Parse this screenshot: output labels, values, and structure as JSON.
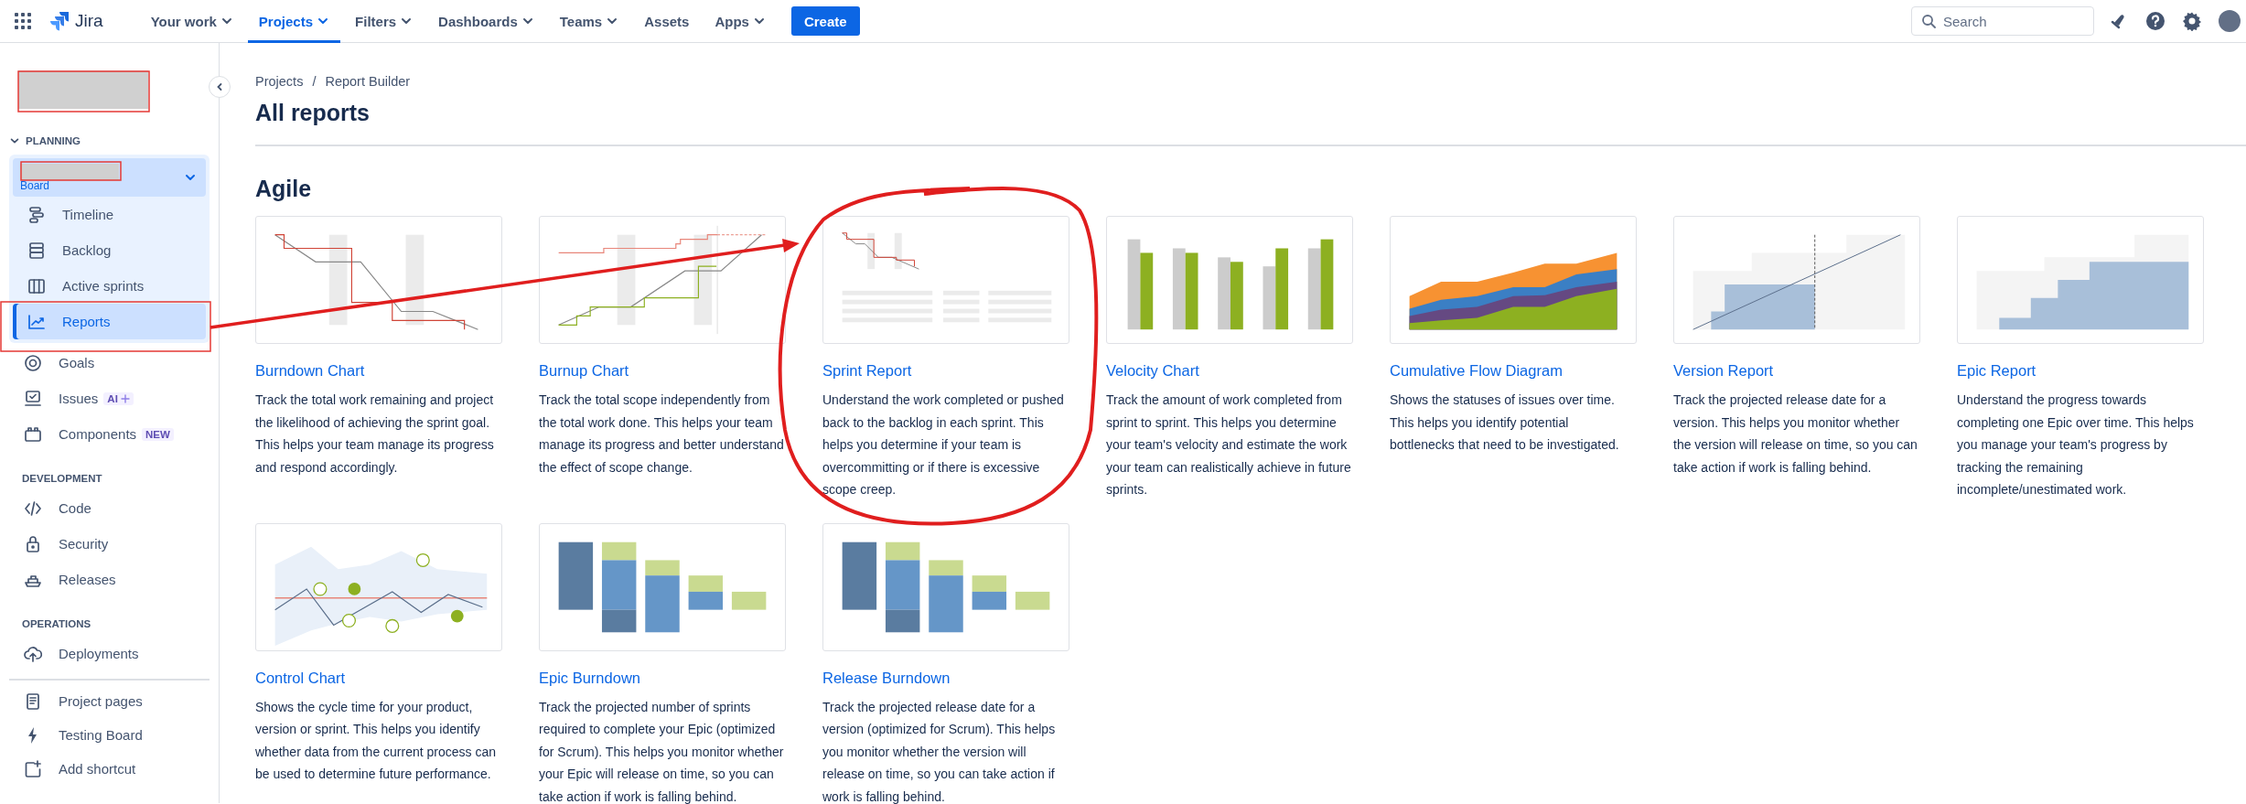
{
  "topbar": {
    "app_name": "Jira",
    "nav": [
      {
        "label": "Your work",
        "selected": false,
        "has_menu": true
      },
      {
        "label": "Projects",
        "selected": true,
        "has_menu": true
      },
      {
        "label": "Filters",
        "selected": false,
        "has_menu": true
      },
      {
        "label": "Dashboards",
        "selected": false,
        "has_menu": true
      },
      {
        "label": "Teams",
        "selected": false,
        "has_menu": true
      },
      {
        "label": "Assets",
        "selected": false,
        "has_menu": false
      },
      {
        "label": "Apps",
        "selected": false,
        "has_menu": true
      }
    ],
    "create_button": "Create",
    "search": {
      "placeholder": "Search"
    }
  },
  "sidebar": {
    "sections": [
      {
        "kind": "planning",
        "heading": "PLANNING",
        "expanded": true,
        "board": {
          "label": "Board",
          "expanded": true,
          "items": [
            {
              "label": "Timeline",
              "selected": false
            },
            {
              "label": "Backlog",
              "selected": false
            },
            {
              "label": "Active sprints",
              "selected": false
            },
            {
              "label": "Reports",
              "selected": true
            }
          ]
        },
        "items": [
          {
            "label": "Goals",
            "selected": false
          },
          {
            "label": "Issues",
            "selected": false,
            "badge": {
              "kind": "ai",
              "text": "AI"
            }
          },
          {
            "label": "Components",
            "selected": false,
            "badge": {
              "kind": "new",
              "text": "NEW"
            }
          }
        ]
      },
      {
        "kind": "plain",
        "heading": "DEVELOPMENT",
        "items": [
          {
            "label": "Code",
            "selected": false
          },
          {
            "label": "Security",
            "selected": false
          },
          {
            "label": "Releases",
            "selected": false
          }
        ]
      },
      {
        "kind": "plain",
        "heading": "OPERATIONS",
        "items": [
          {
            "label": "Deployments",
            "selected": false
          }
        ]
      },
      {
        "kind": "footer",
        "items": [
          {
            "label": "Project pages",
            "selected": false
          },
          {
            "label": "Testing Board",
            "selected": false
          },
          {
            "label": "Add shortcut",
            "selected": false
          }
        ]
      }
    ]
  },
  "main": {
    "breadcrumb": {
      "items": [
        "Projects",
        "Report Builder"
      ],
      "separator": "/"
    },
    "title": "All reports",
    "section_title": "Agile",
    "reports": [
      {
        "title": "Burndown Chart",
        "description": "Track the total work remaining and project the likelihood of achieving the sprint goal. This helps your team manage its progress and respond accordingly."
      },
      {
        "title": "Burnup Chart",
        "description": "Track the total scope independently from the total work done. This helps your team manage its progress and better understand the effect of scope change."
      },
      {
        "title": "Sprint Report",
        "description": "Understand the work completed or pushed back to the backlog in each sprint. This helps you determine if your team is overcommitting or if there is excessive scope creep."
      },
      {
        "title": "Velocity Chart",
        "description": "Track the amount of work completed from sprint to sprint. This helps you determine your team's velocity and estimate the work your team can realistically achieve in future sprints."
      },
      {
        "title": "Cumulative Flow Diagram",
        "description": "Shows the statuses of issues over time. This helps you identify potential bottlenecks that need to be investigated."
      },
      {
        "title": "Version Report",
        "description": "Track the projected release date for a version. This helps you monitor whether the version will release on time, so you can take action if work is falling behind."
      },
      {
        "title": "Epic Report",
        "description": "Understand the progress towards completing one Epic over time. This helps you manage your team's progress by tracking the remaining incomplete/unestimated work."
      },
      {
        "title": "Control Chart",
        "description": "Shows the cycle time for your product, version or sprint. This helps you identify whether data from the current process can be used to determine future performance."
      },
      {
        "title": "Epic Burndown",
        "description": "Track the projected number of sprints required to complete your Epic (optimized for Scrum). This helps you monitor whether your Epic will release on time, so you can take action if work is falling behind."
      },
      {
        "title": "Release Burndown",
        "description": "Track the projected release date for a version (optimized for Scrum). This helps you monitor whether the version will release on time, so you can take action if work is falling behind."
      }
    ]
  },
  "annotations": [
    {
      "kind": "box"
    },
    {
      "kind": "box"
    },
    {
      "kind": "box"
    },
    {
      "kind": "arrow"
    },
    {
      "kind": "circle"
    }
  ]
}
